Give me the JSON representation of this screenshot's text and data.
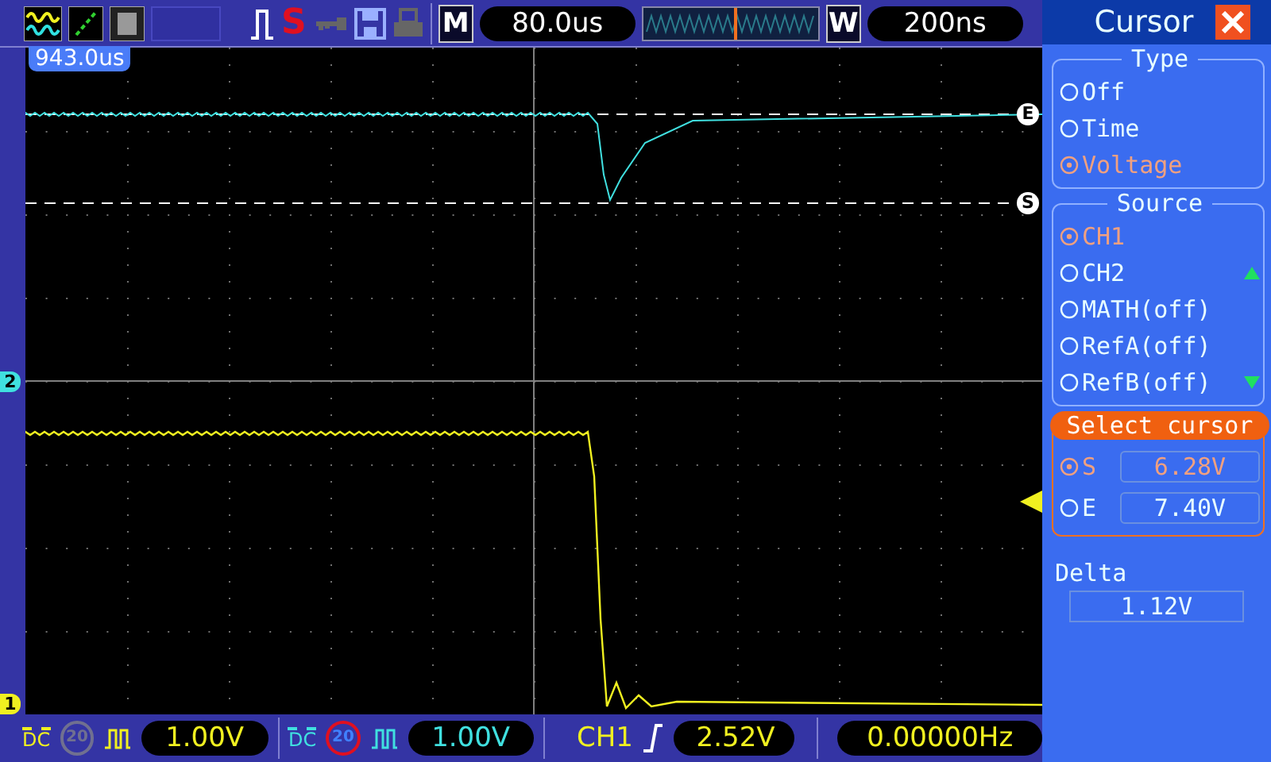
{
  "toolbar": {
    "run_state": "S",
    "timebase_label": "M",
    "timebase": "80.0us",
    "window_label": "W",
    "window": "200ns"
  },
  "screen": {
    "trigger_time": "943.0us",
    "cursor_markers": [
      {
        "label": "E"
      },
      {
        "label": "S"
      }
    ],
    "channel_markers": [
      {
        "label": "2",
        "color": "#40e0e0"
      },
      {
        "label": "1",
        "color": "#f0f020"
      }
    ]
  },
  "panel": {
    "title": "Cursor",
    "groups": [
      {
        "title": "Type",
        "options": [
          {
            "label": "Off",
            "selected": false
          },
          {
            "label": "Time",
            "selected": false
          },
          {
            "label": "Voltage",
            "selected": true
          }
        ]
      },
      {
        "title": "Source",
        "options": [
          {
            "label": "CH1",
            "selected": true
          },
          {
            "label": "CH2",
            "selected": false
          },
          {
            "label": "MATH(off)",
            "selected": false
          },
          {
            "label": "RefA(off)",
            "selected": false
          },
          {
            "label": "RefB(off)",
            "selected": false
          }
        ]
      }
    ],
    "select_cursor": {
      "title": "Select cursor",
      "items": [
        {
          "label": "S",
          "value": "6.28V",
          "selected": true
        },
        {
          "label": "E",
          "value": "7.40V",
          "selected": false
        }
      ]
    },
    "delta": {
      "label": "Delta",
      "value": "1.12V"
    }
  },
  "status_bar": {
    "channels": [
      {
        "coupling": "DC",
        "bw_limit": "20",
        "bw_on": false,
        "volts": "1.00V",
        "color": "#f0f020"
      },
      {
        "coupling": "DC",
        "bw_limit": "20",
        "bw_on": true,
        "volts": "1.00V",
        "color": "#40e0e0"
      }
    ],
    "trigger": {
      "source": "CH1",
      "level": "2.52V"
    },
    "frequency": "0.00000Hz"
  }
}
